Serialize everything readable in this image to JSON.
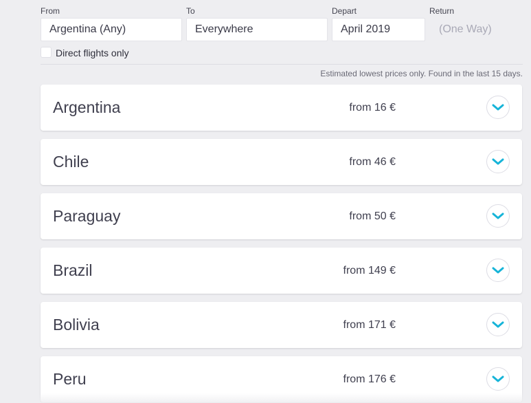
{
  "search": {
    "from": {
      "label": "From",
      "value": "Argentina (Any)"
    },
    "to": {
      "label": "To",
      "value": "Everywhere"
    },
    "depart": {
      "label": "Depart",
      "value": "April 2019"
    },
    "return": {
      "label": "Return",
      "value": "(One Way)"
    },
    "direct_only": {
      "label": "Direct flights only",
      "checked": false
    }
  },
  "disclaimer": "Estimated lowest prices only. Found in the last 15 days.",
  "accent_color": "#16b4d8",
  "results": [
    {
      "country": "Argentina",
      "price": "from 16 €"
    },
    {
      "country": "Chile",
      "price": "from 46 €"
    },
    {
      "country": "Paraguay",
      "price": "from 50 €"
    },
    {
      "country": "Brazil",
      "price": "from 149 €"
    },
    {
      "country": "Bolivia",
      "price": "from 171 €"
    },
    {
      "country": "Peru",
      "price": "from 176 €"
    }
  ]
}
